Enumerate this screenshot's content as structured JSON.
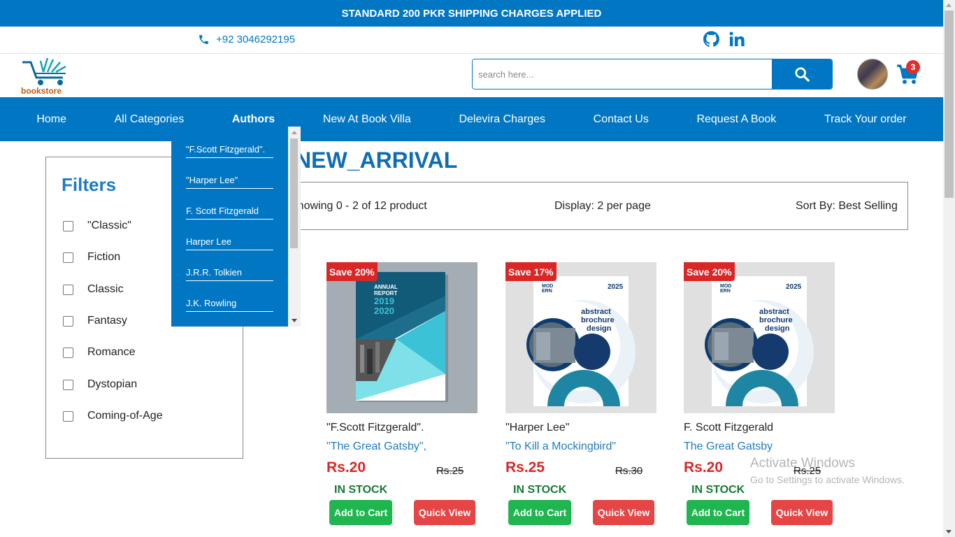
{
  "announcement": "STANDARD 200 PKR SHIPPING CHARGES APPLIED",
  "contact": {
    "phone": "+92 3046292195",
    "phone_icon": "phone-icon"
  },
  "socials": [
    "github-icon",
    "linkedin-icon"
  ],
  "brand": {
    "logo_text": "bookstore"
  },
  "search": {
    "placeholder": "search here..."
  },
  "cart": {
    "count": "3"
  },
  "nav": [
    {
      "label": "Home"
    },
    {
      "label": "All Categories"
    },
    {
      "label": "Authors",
      "active": true
    },
    {
      "label": "New At Book Villa"
    },
    {
      "label": "Delevira Charges"
    },
    {
      "label": "Contact Us"
    },
    {
      "label": "Request A Book"
    },
    {
      "label": "Track Your order"
    }
  ],
  "authors_dropdown": [
    "\"F.Scott Fitzgerald\".",
    "\"Harper Lee\"",
    "F. Scott Fitzgerald",
    "Harper Lee",
    "J.R.R. Tolkien",
    "J.K. Rowling"
  ],
  "filters": {
    "title": "Filters",
    "items": [
      "\"Classic\"",
      "Fiction",
      "Classic",
      "Fantasy",
      "Romance",
      "Dystopian",
      "Coming-of-Age"
    ]
  },
  "section_title": "NEW_ARRIVAL",
  "toolbar": {
    "showing": "Showing 0 - 2 of 12 product",
    "display": "Display: 2 per page",
    "sort": "Sort By: Best Selling"
  },
  "products": [
    {
      "badge": "Save 20%",
      "author": "\"F.Scott Fitzgerald\".",
      "title": "\"The Great Gatsby\",",
      "price": "Rs.20",
      "old_price": "Rs.25",
      "stock": "IN STOCK",
      "add": "Add to Cart",
      "quick": "Quick View"
    },
    {
      "badge": "Save 17%",
      "author": "\"Harper Lee\"",
      "title": "\"To Kill a Mockingbird\"",
      "price": "Rs.25",
      "old_price": "Rs.30",
      "stock": "IN STOCK",
      "add": "Add to Cart",
      "quick": "Quick View"
    },
    {
      "badge": "Save 20%",
      "author": "F. Scott Fitzgerald",
      "title": "The Great Gatsby",
      "price": "Rs.20",
      "old_price": "Rs.25",
      "stock": "IN STOCK",
      "add": "Add to Cart",
      "quick": "Quick View"
    }
  ],
  "cover_text": {
    "annual": "ANNUAL",
    "report": "REPORT",
    "year1": "2019",
    "year2": "2020",
    "mod": "MOD",
    "ern": "ERN",
    "year": "2025",
    "abstract": "abstract",
    "brochure": "brochure",
    "design": "design"
  },
  "watermark": {
    "line1": "Activate Windows",
    "line2": "Go to Settings to activate Windows."
  },
  "colors": {
    "primary": "#0177c4",
    "sale": "#d92727",
    "stock": "#187a35",
    "add": "#1fb650",
    "quick": "#e64545"
  }
}
